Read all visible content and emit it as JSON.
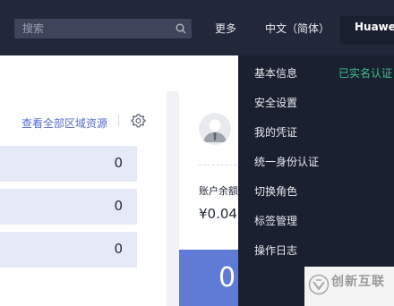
{
  "header": {
    "search_placeholder": "搜索",
    "more_label": "更多",
    "language_label": "中文（简体）",
    "user_label": "Huawei_"
  },
  "resources": {
    "view_all_label": "查看全部区域资源",
    "stats": [
      "0",
      "0",
      "0"
    ]
  },
  "account": {
    "balance_label": "账户余额",
    "balance_value": "¥0.04",
    "big_count": "0"
  },
  "user_menu": {
    "items": [
      "基本信息",
      "安全设置",
      "我的凭证",
      "统一身份认证",
      "切换角色",
      "标签管理",
      "操作日志"
    ],
    "verified_label": "已实名认证"
  },
  "watermark": {
    "text": "创新互联"
  },
  "colors": {
    "topbar": "#22283a",
    "dropdown": "#1b2030",
    "link": "#526ecc",
    "verified": "#3bbf8a",
    "accent_block": "#5f7bd6"
  }
}
